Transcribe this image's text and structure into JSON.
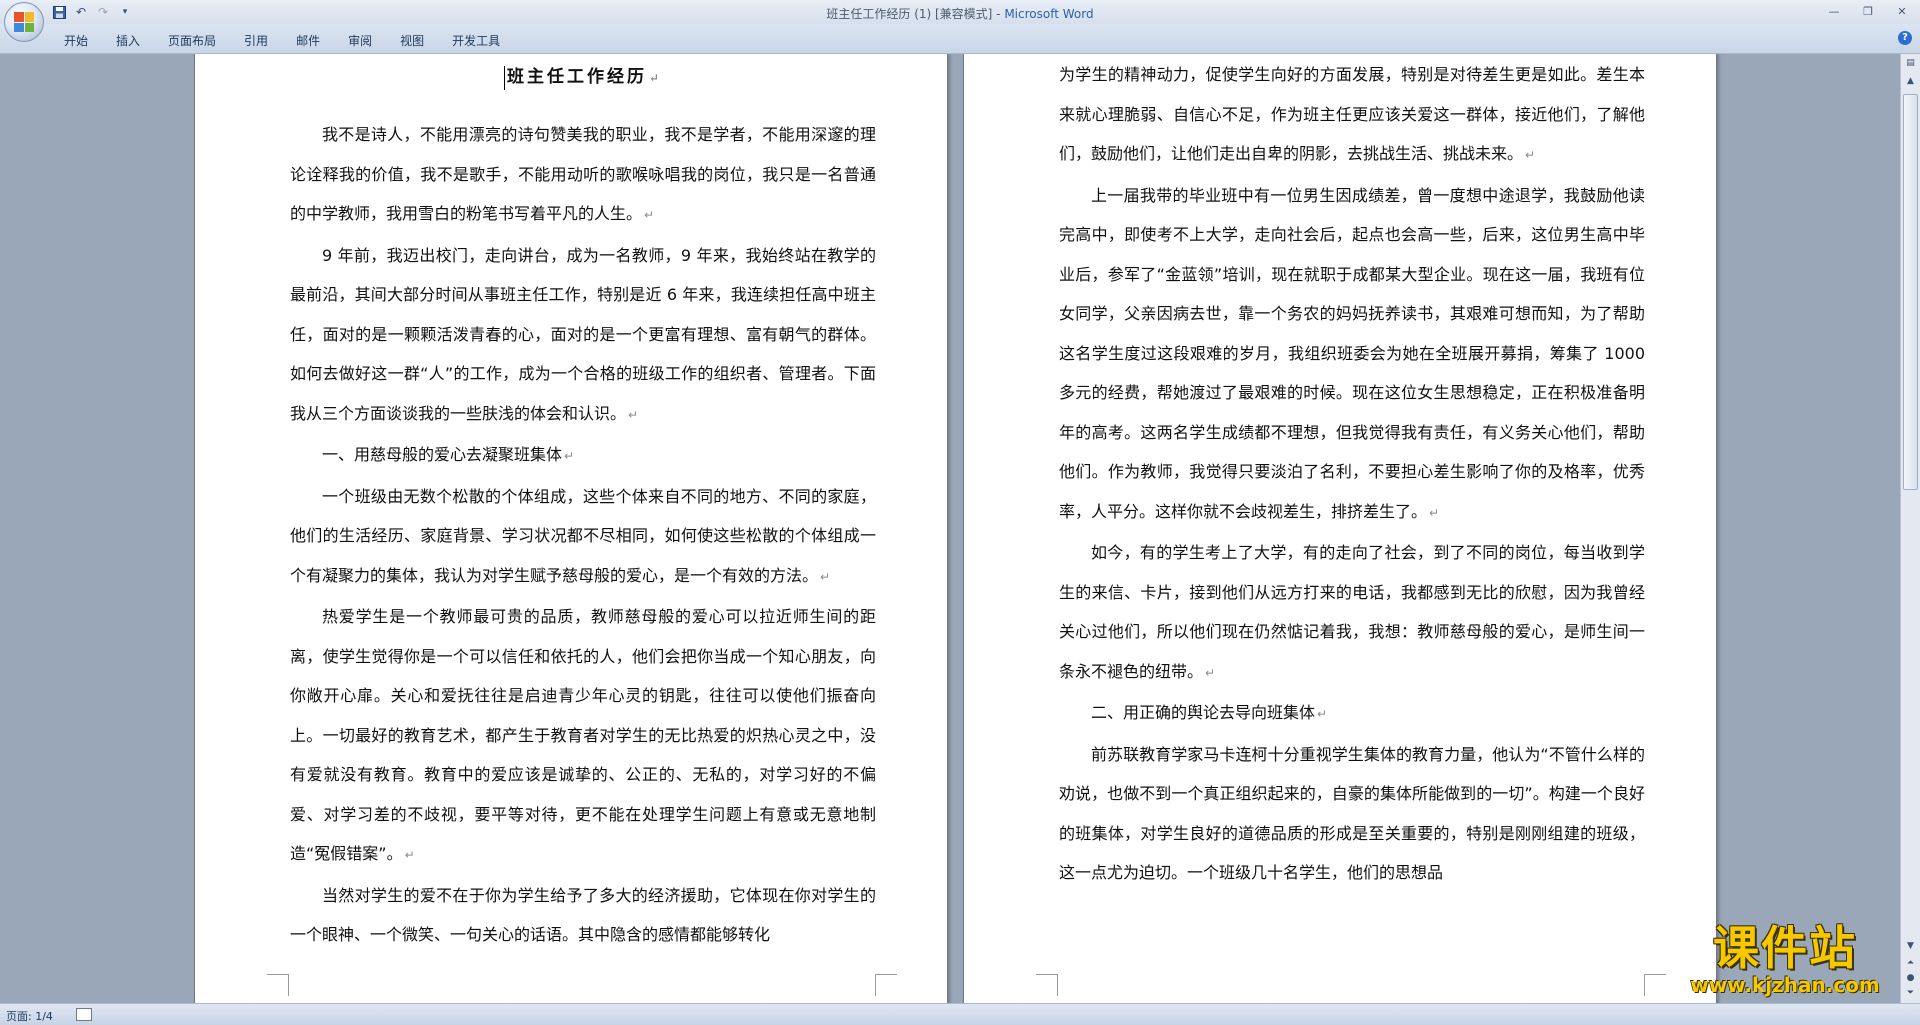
{
  "window": {
    "doc_name": "班主任工作经历 (1) [兼容模式] - ",
    "app_name": "Microsoft Word"
  },
  "ribbon": {
    "tabs": [
      "开始",
      "插入",
      "页面布局",
      "引用",
      "邮件",
      "审阅",
      "视图",
      "开发工具"
    ]
  },
  "document": {
    "title": "班主任工作经历",
    "left_paragraphs": [
      "我不是诗人，不能用漂亮的诗句赞美我的职业，我不是学者，不能用深邃的理论诠释我的价值，我不是歌手，不能用动听的歌喉咏唱我的岗位，我只是一名普通的中学教师，我用雪白的粉笔书写着平凡的人生。",
      "9 年前，我迈出校门，走向讲台，成为一名教师，9 年来，我始终站在教学的最前沿，其间大部分时间从事班主任工作，特别是近 6 年来，我连续担任高中班主任，面对的是一颗颗活泼青春的心，面对的是一个更富有理想、富有朝气的群体。如何去做好这一群“人”的工作，成为一个合格的班级工作的组织者、管理者。下面我从三个方面谈谈我的一些肤浅的体会和认识。",
      "一、用慈母般的爱心去凝聚班集体",
      "一个班级由无数个松散的个体组成，这些个体来自不同的地方、不同的家庭，他们的生活经历、家庭背景、学习状况都不尽相同，如何使这些松散的个体组成一个有凝聚力的集体，我认为对学生赋予慈母般的爱心，是一个有效的方法。",
      "热爱学生是一个教师最可贵的品质，教师慈母般的爱心可以拉近师生间的距离，使学生觉得你是一个可以信任和依托的人，他们会把你当成一个知心朋友，向你敞开心扉。关心和爱抚往往是启迪青少年心灵的钥匙，往往可以使他们振奋向上。一切最好的教育艺术，都产生于教育者对学生的无比热爱的炽热心灵之中，没有爱就没有教育。教育中的爱应该是诚挚的、公正的、无私的，对学习好的不偏爱、对学习差的不歧视，要平等对待，更不能在处理学生问题上有意或无意地制造“冤假错案”。",
      "当然对学生的爱不在于你为学生给予了多大的经济援助，它体现在你对学生的一个眼神、一个微笑、一句关心的话语。其中隐含的感情都能够转化"
    ],
    "right_paragraphs": [
      "为学生的精神动力，促使学生向好的方面发展，特别是对待差生更是如此。差生本来就心理脆弱、自信心不足，作为班主任更应该关爱这一群体，接近他们，了解他们，鼓励他们，让他们走出自卑的阴影，去挑战生活、挑战未来。",
      "上一届我带的毕业班中有一位男生因成绩差，曾一度想中途退学，我鼓励他读完高中，即使考不上大学，走向社会后，起点也会高一些，后来，这位男生高中毕业后，参军了“金蓝领”培训，现在就职于成都某大型企业。现在这一届，我班有位女同学，父亲因病去世，靠一个务农的妈妈抚养读书，其艰难可想而知，为了帮助这名学生度过这段艰难的岁月，我组织班委会为她在全班展开募捐，筹集了 1000 多元的经费，帮她渡过了最艰难的时候。现在这位女生思想稳定，正在积极准备明年的高考。这两名学生成绩都不理想，但我觉得我有责任，有义务关心他们，帮助他们。作为教师，我觉得只要淡泊了名利，不要担心差生影响了你的及格率，优秀率，人平分。这样你就不会歧视差生，排挤差生了。",
      "如今，有的学生考上了大学，有的走向了社会，到了不同的岗位，每当收到学生的来信、卡片，接到他们从远方打来的电话，我都感到无比的欣慰，因为我曾经关心过他们，所以他们现在仍然惦记着我，我想：教师慈母般的爱心，是师生间一条永不褪色的纽带。",
      "二、用正确的舆论去导向班集体",
      "前苏联教育学家马卡连柯十分重视学生集体的教育力量，他认为“不管什么样的劝说，也做不到一个真正组织起来的，自豪的集体所能做到的一切”。构建一个良好的班集体，对学生良好的道德品质的形成是至关重要的，特别是刚刚组建的班级，这一点尤为迫切。一个班级几十名学生，他们的思想品"
    ],
    "paragraph_mark": "↵"
  },
  "status": {
    "page": "页面: 1/4"
  },
  "watermark": {
    "main": "课件站",
    "url": "www.kjzhan.com"
  }
}
